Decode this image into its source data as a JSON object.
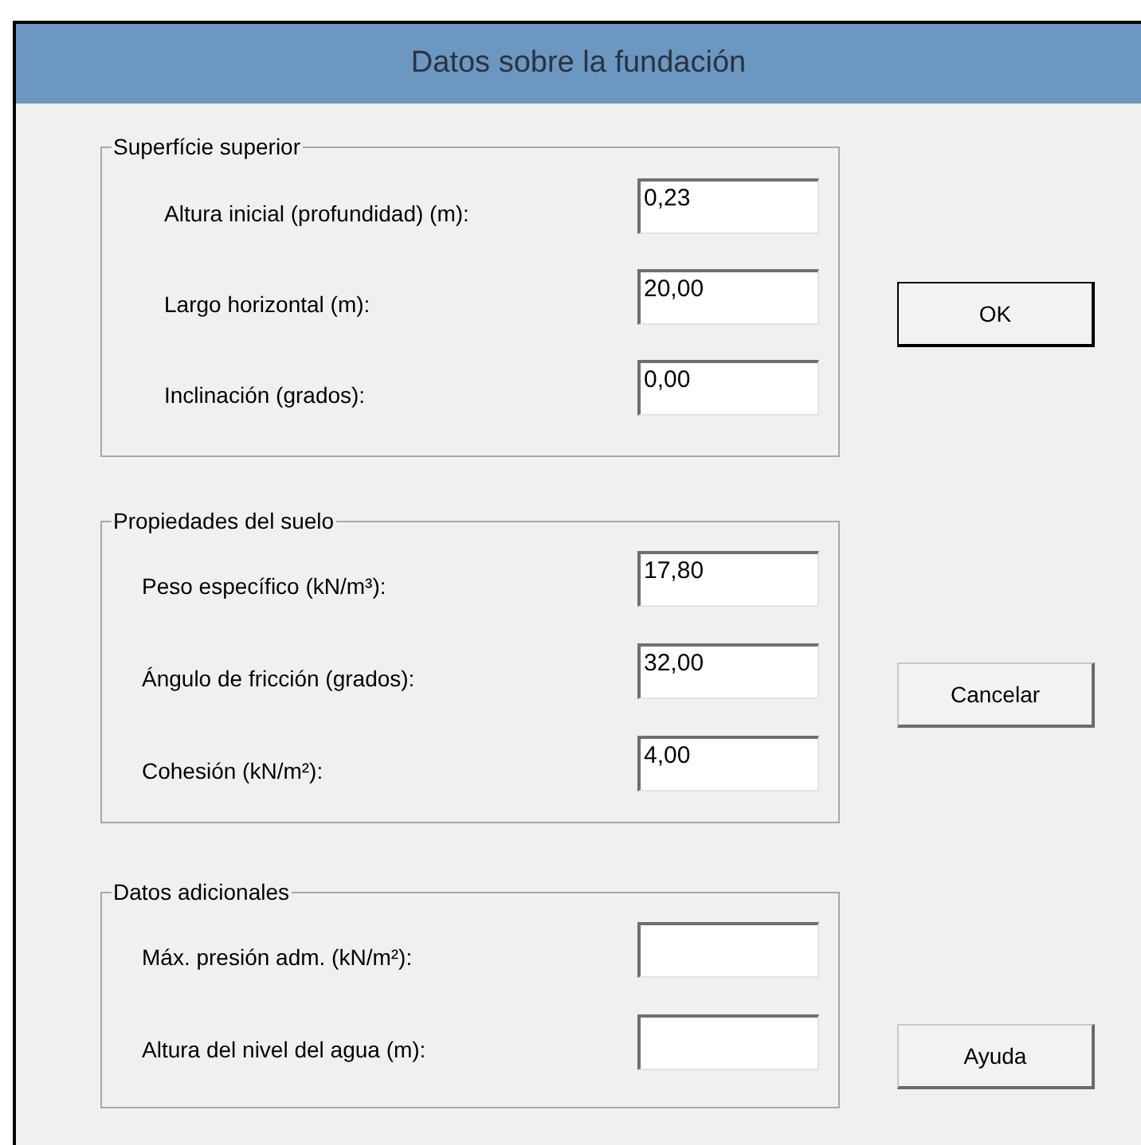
{
  "window": {
    "title": "Datos sobre la fundación"
  },
  "groups": [
    {
      "title": "Superfície superior",
      "fields": [
        {
          "label": "Altura inicial (profundidad) (m):",
          "value": "0,23"
        },
        {
          "label": "Largo horizontal (m):",
          "value": "20,00"
        },
        {
          "label": "Inclinación (grados):",
          "value": "0,00"
        }
      ]
    },
    {
      "title": "Propiedades del suelo",
      "fields": [
        {
          "label": "Peso específico (kN/m³):",
          "value": "17,80"
        },
        {
          "label": "Ángulo de fricción (grados):",
          "value": "32,00"
        },
        {
          "label": "Cohesión (kN/m²):",
          "value": "4,00"
        }
      ]
    },
    {
      "title": "Datos adicionales",
      "fields": [
        {
          "label": "Máx. presión adm. (kN/m²):"
        },
        {
          "label": "Altura del nivel del agua (m):"
        }
      ]
    }
  ],
  "buttons": [
    {
      "label": "OK",
      "default": true
    },
    {
      "label": "Cancelar",
      "default": false
    },
    {
      "label": "Ayuda",
      "default": false
    }
  ]
}
